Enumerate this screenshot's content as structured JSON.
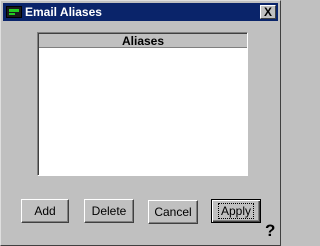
{
  "window": {
    "title": "Email Aliases",
    "close_label": "X"
  },
  "list": {
    "header": "Aliases",
    "items": []
  },
  "buttons": {
    "add": "Add",
    "delete": "Delete",
    "cancel": "Cancel",
    "apply": "Apply"
  },
  "help": {
    "label": "?"
  },
  "colors": {
    "titlebar": "#0a246a",
    "face": "#c0c0c0",
    "list_bg": "#ffffff"
  }
}
